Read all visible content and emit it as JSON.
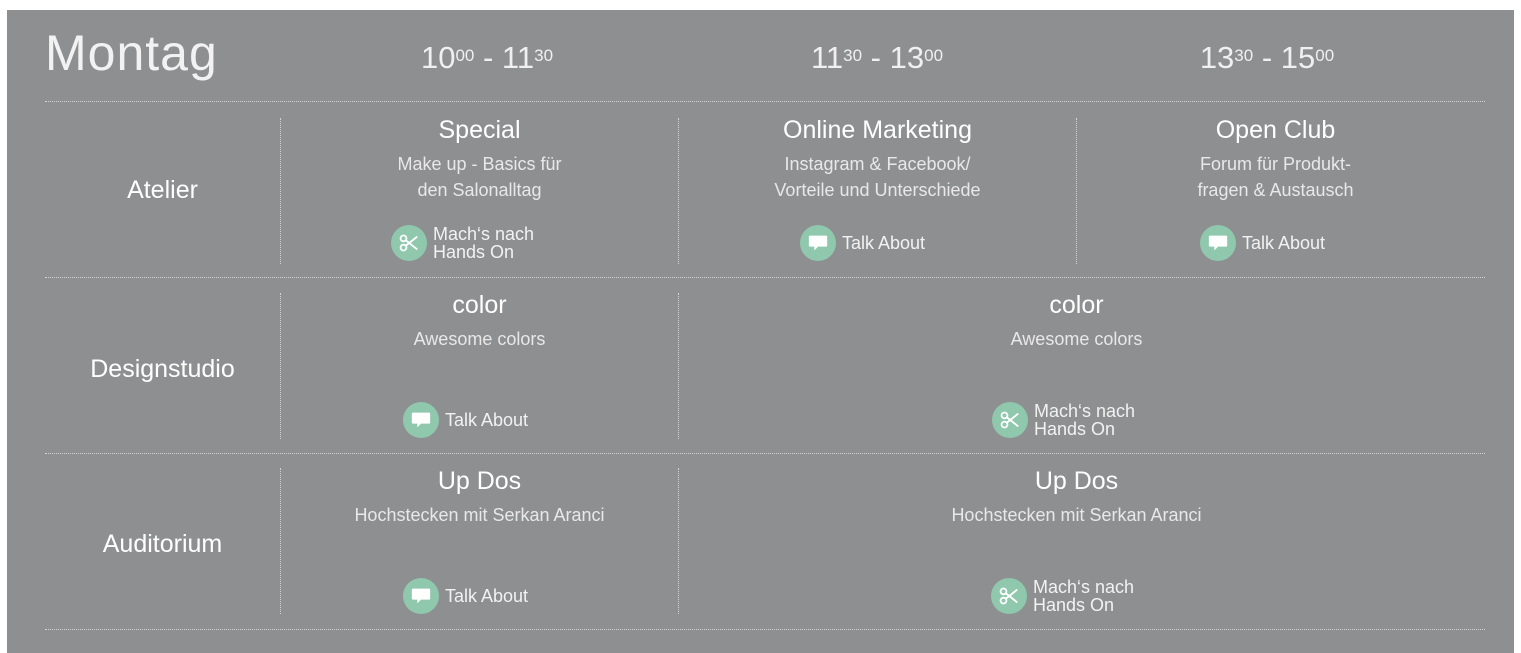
{
  "day": "Montag",
  "times": [
    {
      "start_h": "10",
      "start_m": "00",
      "end_h": "11",
      "end_m": "30"
    },
    {
      "start_h": "11",
      "start_m": "30",
      "end_h": "13",
      "end_m": "00"
    },
    {
      "start_h": "13",
      "start_m": "30",
      "end_h": "15",
      "end_m": "00"
    }
  ],
  "rooms": {
    "atelier": "Atelier",
    "designstudio": "Designstudio",
    "auditorium": "Auditorium"
  },
  "sessions": {
    "atelier_1": {
      "title": "Special",
      "desc1": "Make up -  Basics für",
      "desc2": "den Salonalltag",
      "tag1": "Mach‘s nach",
      "tag2": "Hands On"
    },
    "atelier_2": {
      "title": "Online Marketing",
      "desc1": "Instagram & Facebook/",
      "desc2": "Vorteile und Unterschiede",
      "tag1": "Talk About"
    },
    "atelier_3": {
      "title": "Open Club",
      "desc1": "Forum für Produkt-",
      "desc2": "fragen & Austausch",
      "tag1": "Talk About"
    },
    "design_1": {
      "title": "color",
      "desc1": "Awesome colors",
      "tag1": "Talk About"
    },
    "design_2": {
      "title": "color",
      "desc1": "Awesome colors",
      "tag1": "Mach‘s nach",
      "tag2": "Hands On"
    },
    "audit_1": {
      "title": "Up Dos",
      "desc1": "Hochstecken mit Serkan Aranci",
      "tag1": "Talk About"
    },
    "audit_2": {
      "title": "Up Dos",
      "desc1": "Hochstecken mit Serkan Aranci",
      "tag1": "Mach‘s nach",
      "tag2": "Hands On"
    }
  },
  "icons": {
    "talk": "speech-bubble-icon",
    "hands_on": "scissors-icon"
  },
  "colors": {
    "background": "#8e8f91",
    "accent": "#8fc8ad"
  }
}
